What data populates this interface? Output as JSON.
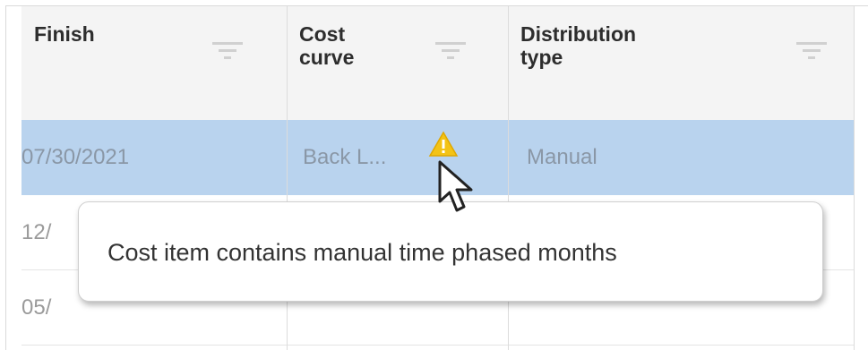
{
  "columns": [
    {
      "key": "finish",
      "label": "Finish"
    },
    {
      "key": "cost_curve",
      "label": "Cost\ncurve"
    },
    {
      "key": "distribution_type",
      "label": "Distribution\ntype"
    }
  ],
  "rows": [
    {
      "finish": "07/30/2021",
      "cost_curve": "Back L...",
      "distribution_type": "Manual",
      "selected": true,
      "warning": true
    },
    {
      "finish": "12/",
      "cost_curve": "",
      "distribution_type": ""
    },
    {
      "finish": "05/",
      "cost_curve": "",
      "distribution_type": ""
    }
  ],
  "tooltip": {
    "text": "Cost item contains manual time phased months"
  },
  "colors": {
    "selected_row": "#b9d3ee",
    "header_bg": "#f4f4f4",
    "warning_icon": "#f3c316"
  },
  "icons": {
    "filter": "filter-icon",
    "warning": "warning-icon",
    "cursor": "mouse-pointer-icon"
  }
}
